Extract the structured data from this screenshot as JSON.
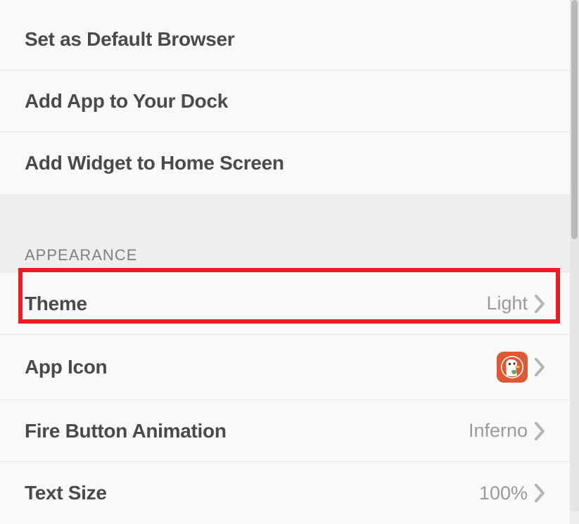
{
  "top_section": {
    "items": [
      {
        "label": "Set as Default Browser"
      },
      {
        "label": "Add App to Your Dock"
      },
      {
        "label": "Add Widget to Home Screen"
      }
    ]
  },
  "appearance": {
    "header": "APPEARANCE",
    "items": [
      {
        "label": "Theme",
        "value": "Light"
      },
      {
        "label": "App Icon",
        "value": ""
      },
      {
        "label": "Fire Button Animation",
        "value": "Inferno"
      },
      {
        "label": "Text Size",
        "value": "100%"
      }
    ]
  }
}
